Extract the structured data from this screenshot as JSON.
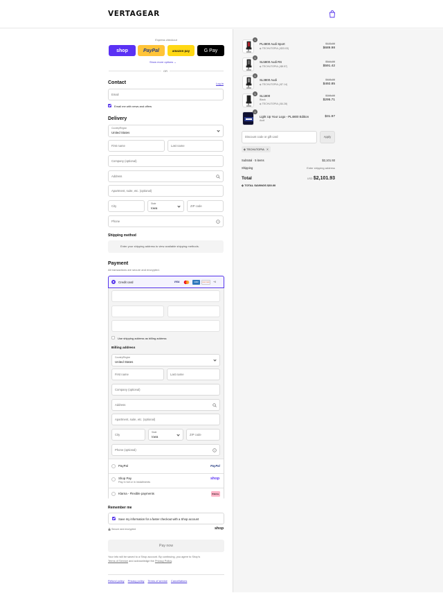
{
  "header": {
    "brand": "VERTAGEAR"
  },
  "express": {
    "label": "Express checkout",
    "buttons": [
      {
        "label": "shop",
        "color": "#5a31f4"
      },
      {
        "label": "PayPal",
        "color": "#ffc439"
      },
      {
        "label": "amazon pay",
        "color": "#ffd814"
      },
      {
        "label": "G Pay",
        "color": "#000000"
      }
    ],
    "more": "Show more options",
    "or": "OR"
  },
  "contact": {
    "title": "Contact",
    "login": "Log in",
    "email_placeholder": "Email",
    "newsletter": "Email me with news and offers"
  },
  "delivery": {
    "title": "Delivery",
    "country_label": "Country/Region",
    "country": "United States",
    "first_name": "First name",
    "last_name": "Last name",
    "company": "Company (optional)",
    "address": "Address",
    "apartment": "Apartment, suite, etc. (optional)",
    "city": "City",
    "state_label": "State",
    "state": "Iowa",
    "zip": "ZIP code",
    "phone": "Phone"
  },
  "shipping_method": {
    "title": "Shipping method",
    "message": "Enter your shipping address to view available shipping methods."
  },
  "payment": {
    "title": "Payment",
    "subtitle": "All transactions are secure and encrypted.",
    "credit_card": "Credit card",
    "card_icons": [
      "VISA",
      "MC",
      "AMEX",
      "DISCOVER"
    ],
    "more_cards": "+6",
    "use_shipping": "Use shipping address as billing address",
    "billing_title": "Billing address",
    "billing": {
      "country_label": "Country/Region",
      "country": "United States",
      "first_name": "First name",
      "last_name": "Last name",
      "company": "Company (optional)",
      "address": "Address",
      "apartment": "Apartment, suite, etc. (optional)",
      "city": "City",
      "state_label": "State",
      "state": "Iowa",
      "zip": "ZIP code",
      "phone": "Phone (optional)"
    },
    "paypal": "PayPal",
    "paypal_logo": "PayPal",
    "shoppay": "Shop Pay",
    "shoppay_sub": "Pay in full or in installments",
    "shoppay_logo": "shop",
    "klarna": "Klarna - Flexible payments",
    "klarna_logo": "Klarna."
  },
  "remember": {
    "title": "Remember me",
    "save": "Save my information for a faster checkout with a Shop account",
    "secure": "Secure and encrypted",
    "shop_logo": "shop"
  },
  "pay_now": "Pay now",
  "legal": {
    "line1": "Your info will be saved to a Shop account. By continuing, you agree to Shop's",
    "terms": "Terms of Service",
    "and": "and acknowledge the",
    "privacy": "Privacy Policy",
    "period": "."
  },
  "footer_links": [
    "Refund policy",
    "Privacy policy",
    "Terms of service",
    "Cancellations"
  ],
  "summary": {
    "items": [
      {
        "qty": "1",
        "name": "PL4800 Audi Sport",
        "variant": "",
        "discount": "TECHUTOPIA (-$33.03)",
        "original": "$120.99",
        "price": "$689.98"
      },
      {
        "qty": "1",
        "name": "SL5800 Audi RS",
        "variant": "",
        "discount": "TECHUTOPIA (-$8.57)",
        "original": "$544.99",
        "price": "$591.42"
      },
      {
        "qty": "1",
        "name": "SL3800 Audi",
        "variant": "",
        "discount": "TECHUTOPIA (-$7.14)",
        "original": "$499.99",
        "price": "$492.85"
      },
      {
        "qty": "1",
        "name": "SL1800",
        "variant": "Black",
        "discount": "TECHUTOPIA (-$4.28)",
        "original": "$299.99",
        "price": "$295.71"
      },
      {
        "qty": "1",
        "name": "Light Up Your Logo - PL4800 Edition",
        "variant": "Audi",
        "discount": "",
        "original": "",
        "price": "$31.97"
      }
    ],
    "discount_placeholder": "Discount code or gift card",
    "apply": "Apply",
    "applied_code": "TECHUTOPIA",
    "subtotal_label": "Subtotal · 5 items",
    "subtotal": "$2,101.93",
    "shipping_label": "Shipping",
    "shipping": "Enter shipping address",
    "total_label": "Total",
    "currency": "USD",
    "total": "$2,101.93",
    "savings_label": "TOTAL SAVINGS",
    "savings": "$30.00"
  }
}
